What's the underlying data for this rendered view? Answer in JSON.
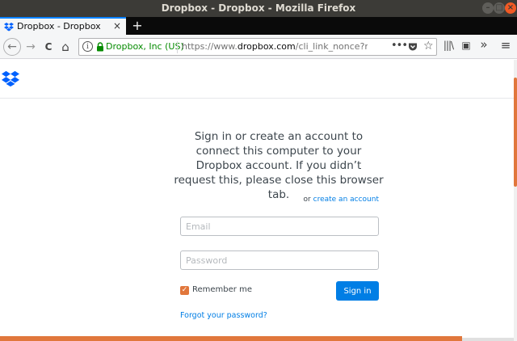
{
  "window": {
    "title": "Dropbox - Dropbox - Mozilla Firefox",
    "minimize_glyph": "–",
    "maximize_glyph": "□",
    "close_glyph": "×"
  },
  "tabs": [
    {
      "title": "Dropbox - Dropbox",
      "close_glyph": "×",
      "icon": "dropbox-icon"
    }
  ],
  "new_tab_glyph": "+",
  "nav": {
    "back_glyph": "←",
    "forward_glyph": "→",
    "reload_glyph": "C",
    "home_glyph": "⌂",
    "info_glyph": "i",
    "identity": "Dropbox, Inc (US)",
    "url_prefix": "https://www.",
    "url_host": "dropbox.com",
    "url_rest": "/cli_link_nonce?nonce=",
    "page_actions_glyph": "•••",
    "star_glyph": "☆",
    "library_glyph": "|||\\",
    "sidebar_glyph": "▣",
    "overflow_glyph": "»",
    "menu_glyph": "≡"
  },
  "page": {
    "heading": "Sign in or create an account to connect this computer to your Dropbox account. If you didn’t request this, please close this browser tab.",
    "or_text": "or ",
    "create_account": "create an account",
    "email_placeholder": "Email",
    "password_placeholder": "Password",
    "remember_label": "Remember me",
    "checkbox_glyph": "✓",
    "signin_label": "Sign in",
    "forgot_label": "Forgot your password?"
  },
  "colors": {
    "accent": "#007ee5",
    "checkbox": "#e1773c",
    "identity_green": "#058b00"
  }
}
